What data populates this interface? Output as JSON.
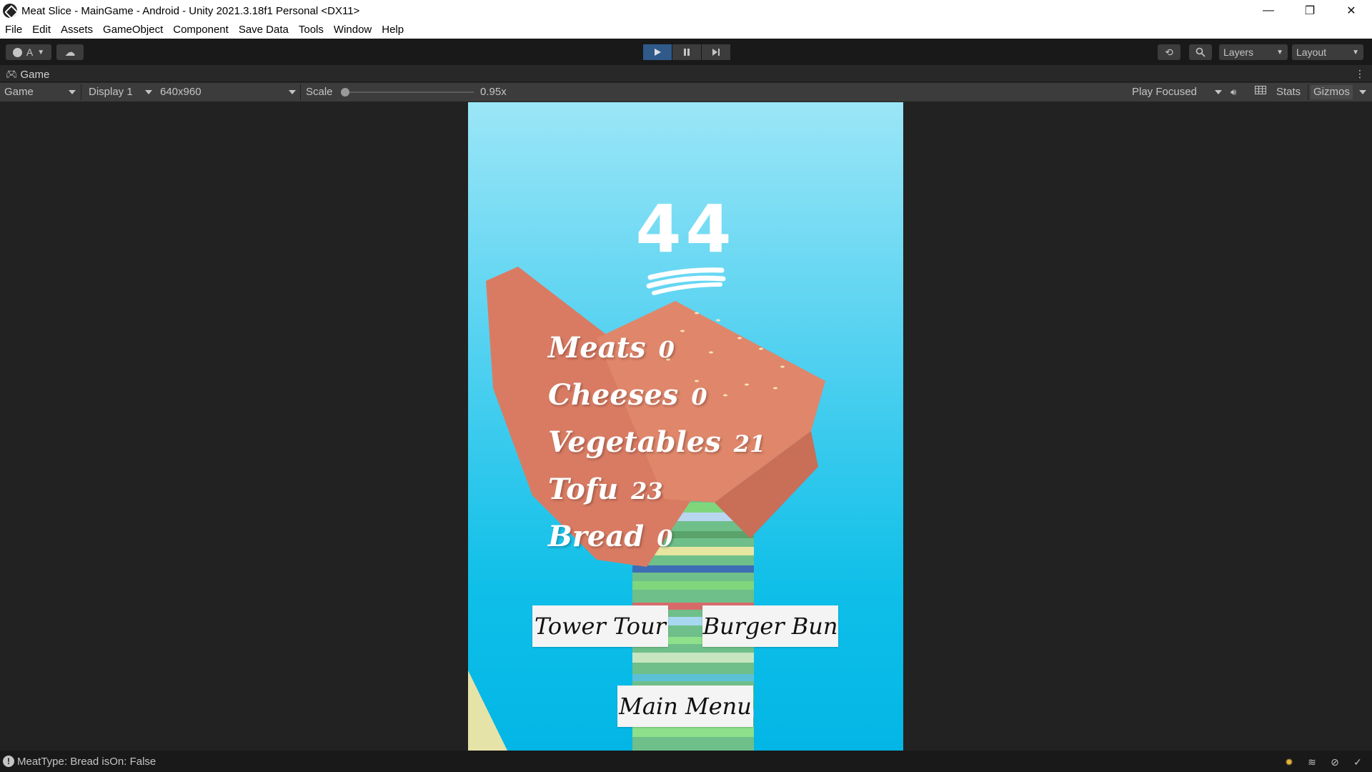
{
  "window": {
    "title": "Meat Slice - MainGame - Android - Unity 2021.3.18f1 Personal <DX11>",
    "controls": [
      "—",
      "❐",
      "✕"
    ]
  },
  "menu": [
    "File",
    "Edit",
    "Assets",
    "GameObject",
    "Component",
    "Save Data",
    "Tools",
    "Window",
    "Help"
  ],
  "toolbar": {
    "account_label": "A",
    "layers_label": "Layers",
    "layout_label": "Layout"
  },
  "tab": {
    "label": "Game"
  },
  "gamebar": {
    "mode": "Game",
    "display": "Display 1",
    "resolution": "640x960",
    "scale_label": "Scale",
    "scale_value": "0.95x",
    "play_focused": "Play Focused",
    "stats": "Stats",
    "gizmos": "Gizmos"
  },
  "game": {
    "score": "44",
    "stats": [
      {
        "label": "Meats",
        "value": "0"
      },
      {
        "label": "Cheeses",
        "value": "0"
      },
      {
        "label": "Vegetables",
        "value": "21"
      },
      {
        "label": "Tofu",
        "value": "23"
      },
      {
        "label": "Bread",
        "value": "0"
      }
    ],
    "buttons": {
      "tower_tour": "Tower Tour",
      "burger_bun": "Burger Bun",
      "main_menu": "Main Menu"
    }
  },
  "status": {
    "message": "MeatType: Bread isOn: False"
  },
  "colors": {
    "sky_top": "#9be6f7",
    "sky_bottom": "#03b6e6",
    "play_active": "#2f5a8a",
    "bread": "#e0866a"
  }
}
